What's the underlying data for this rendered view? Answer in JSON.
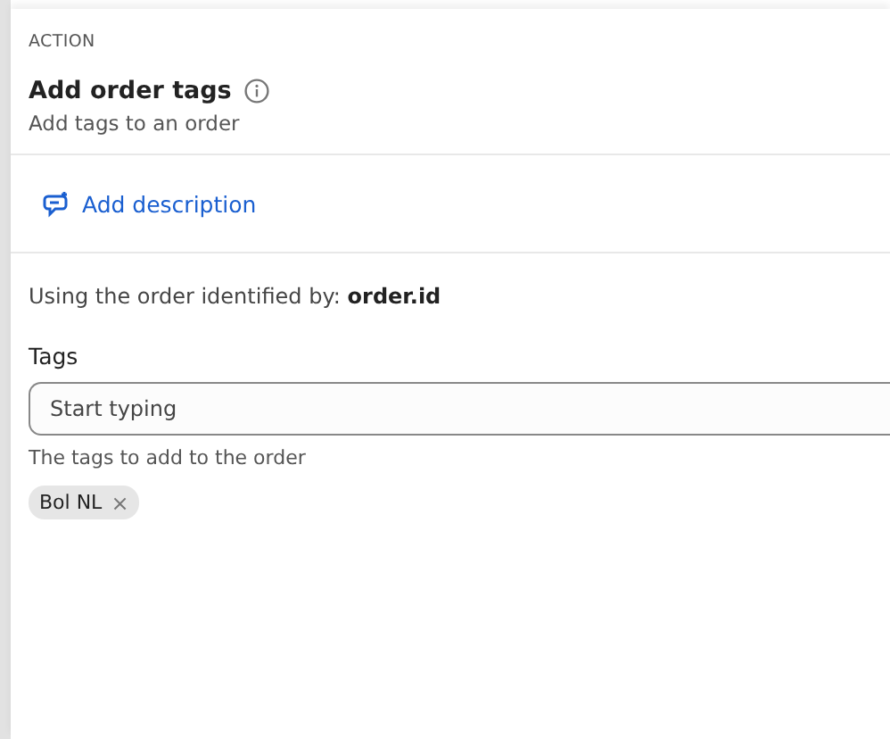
{
  "header": {
    "eyebrow": "ACTION",
    "title": "Add order tags",
    "subtitle": "Add tags to an order"
  },
  "add_description": {
    "label": "Add description"
  },
  "identifier": {
    "text": "Using the order identified by: **order.id**"
  },
  "tags_field": {
    "label": "Tags",
    "placeholder": "Start typing",
    "help": "The tags to add to the order"
  },
  "tags": [
    {
      "label": "Bol NL",
      "remove": "×"
    }
  ]
}
